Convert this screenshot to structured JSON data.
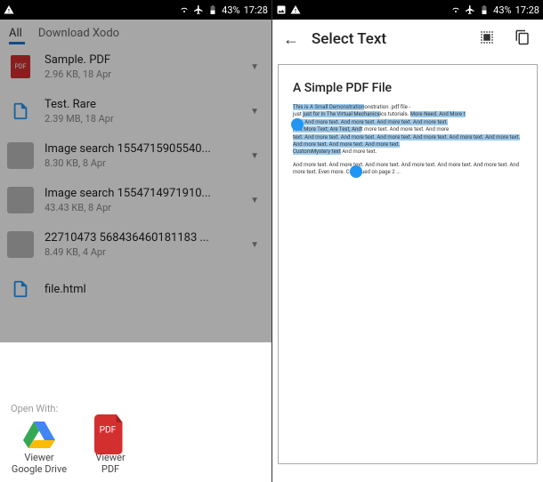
{
  "status": {
    "battery": "43%",
    "time": "17:28"
  },
  "tabs": {
    "all": "All",
    "download": "Download Xodo"
  },
  "files": [
    {
      "name": "Sample. PDF",
      "info": "2.96 KB,  18 Apr",
      "kind": "pdf"
    },
    {
      "name": "Test. Rare",
      "info": "2.39 MB,  18 Apr",
      "kind": "file"
    },
    {
      "name": "Image  search  1554715905540...",
      "info": "8.30 KB,  8 Apr",
      "kind": "img1"
    },
    {
      "name": "Image  search  1554714971910...",
      "info": "43.43 KB,  8 Apr",
      "kind": "img2"
    },
    {
      "name": "22710473  568436460181183 ...",
      "info": "8.49 KB,  4 Apr",
      "kind": "img3"
    },
    {
      "name": "file.html",
      "info": "",
      "kind": "file"
    }
  ],
  "sheet": {
    "title": "Open With:",
    "apps": [
      {
        "label1": "Viewer",
        "label2": "Google Drive"
      },
      {
        "label1": "Viewer",
        "label2": "PDF"
      }
    ]
  },
  "right": {
    "title": "Select Text",
    "pdf": {
      "heading": "A Simple PDF File",
      "line1a": "This is A Small Demonstration",
      "line1b": "onstration .pdf file -",
      "line2a": "just for In The Virtual Mechanics",
      "line2b": "ics tutorials.",
      "line2c": "More Need. And More t",
      "line3": "text. And more text. And more text. And more text. And more text.",
      "line4a": "And More Text; Are Test, And",
      "line4b": "t more text. And more text. And more",
      "line5": "text. And more text. And more text. And more text. And more text. And more text. And more text. And more text. And more text. And more text.",
      "line6a": "CustomMystery text",
      "line6b": "And more text.",
      "para2": "And more text. And more text. And more text. And more text. And more text. And more text. And more text. Even more. Continued on page 2 ..."
    }
  }
}
